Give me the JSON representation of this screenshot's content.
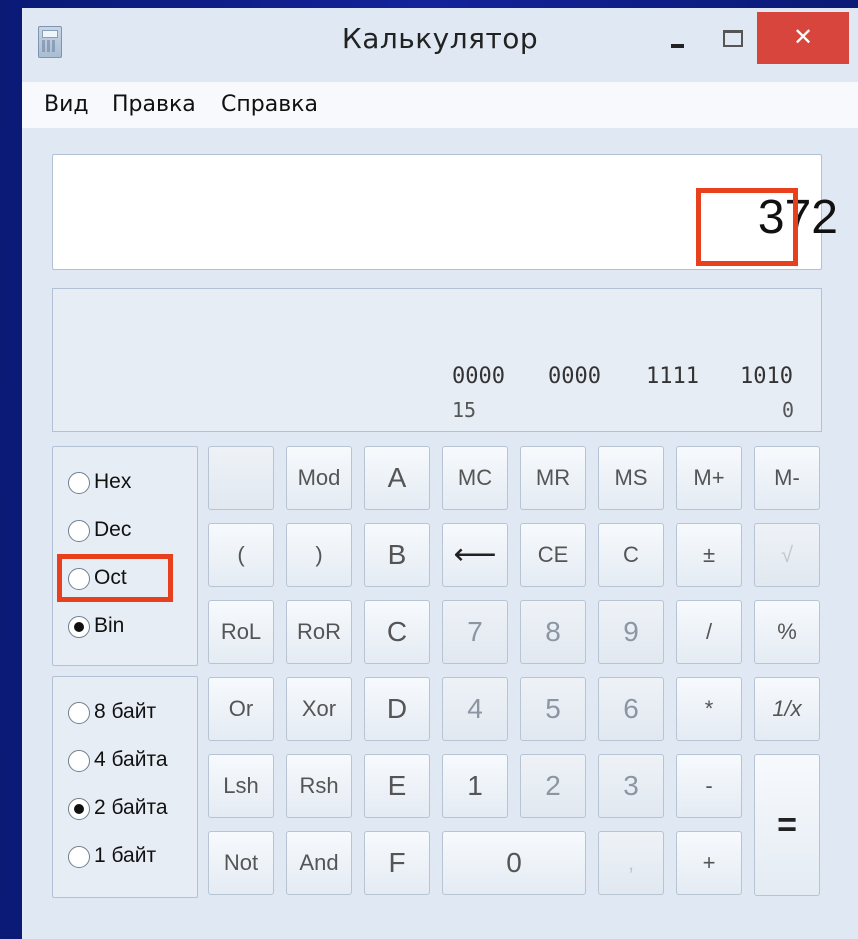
{
  "window": {
    "title": "Калькулятор",
    "close_symbol": "✕"
  },
  "menu": {
    "items": [
      "Вид",
      "Правка",
      "Справка"
    ]
  },
  "display": {
    "value": "372"
  },
  "bits": {
    "groups": [
      "0000",
      "0000",
      "1111",
      "1010"
    ],
    "left_index": "15",
    "right_index": "0"
  },
  "base_radios": {
    "options": [
      "Hex",
      "Dec",
      "Oct",
      "Bin"
    ],
    "selected": "Bin"
  },
  "size_radios": {
    "options": [
      "8 байт",
      "4 байта",
      "2 байта",
      "1 байт"
    ],
    "selected": "2 байта"
  },
  "buttons": {
    "blank": "",
    "mod": "Mod",
    "a": "A",
    "mc": "MC",
    "mr": "MR",
    "ms": "MS",
    "mplus": "M+",
    "mminus": "M-",
    "lparen": "(",
    "rparen": ")",
    "b": "B",
    "backspace": "⟵",
    "ce": "CE",
    "c_clear": "C",
    "plusminus": "±",
    "sqrt": "√",
    "rol": "RoL",
    "ror": "RoR",
    "c": "C",
    "d7": "7",
    "d8": "8",
    "d9": "9",
    "divide": "/",
    "percent": "%",
    "or": "Or",
    "xor": "Xor",
    "d": "D",
    "d4": "4",
    "d5": "5",
    "d6": "6",
    "multiply": "*",
    "reciprocal": "1/x",
    "lsh": "Lsh",
    "rsh": "Rsh",
    "e": "E",
    "d1": "1",
    "d2": "2",
    "d3": "3",
    "minus": "-",
    "equals": "=",
    "not": "Not",
    "and": "And",
    "f": "F",
    "d0": "0",
    "comma": ",",
    "plus": "+"
  },
  "colors": {
    "highlight": "#e8401c",
    "close_button": "#d8453c",
    "outer_background": "#0b1a6e"
  }
}
